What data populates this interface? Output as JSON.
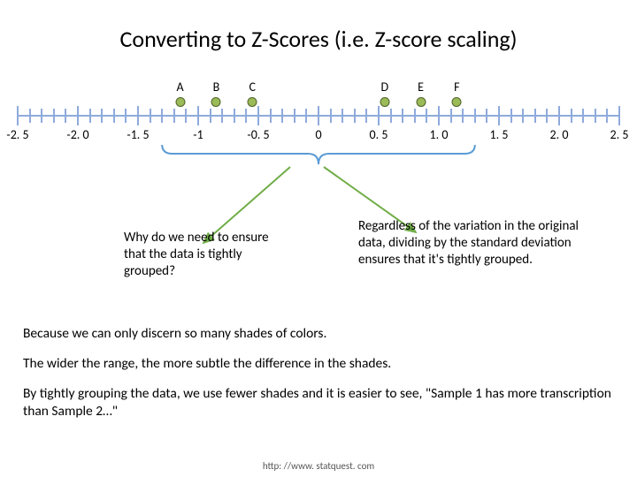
{
  "title": "Converting to Z-Scores (i.e. Z-score scaling)",
  "chart_data": {
    "type": "scatter",
    "xlim": [
      -2.5,
      2.5
    ],
    "xticks_major": [
      -2.5,
      -2.0,
      -1.5,
      -1,
      -0.5,
      0,
      0.5,
      1.0,
      1.5,
      2.0,
      2.5
    ],
    "xtick_labels": [
      "-2. 5",
      "-2. 0",
      "-1. 5",
      "-1",
      "-0. 5",
      "0",
      "0. 5",
      "1. 0",
      "1. 5",
      "2. 0",
      "2. 5"
    ],
    "points": [
      {
        "label": "A",
        "x": -1.15
      },
      {
        "label": "B",
        "x": -0.85
      },
      {
        "label": "C",
        "x": -0.55
      },
      {
        "label": "D",
        "x": 0.55
      },
      {
        "label": "E",
        "x": 0.85
      },
      {
        "label": "F",
        "x": 1.15
      }
    ],
    "brace_range": [
      -1.3,
      1.3
    ],
    "title": "",
    "xlabel": "",
    "ylabel": ""
  },
  "left_text": "Why do we need to ensure that the data is tightly grouped?",
  "right_text": "Regardless of the variation in the original data, dividing by the standard deviation ensures that it's tightly grouped.",
  "para1": "Because we can only discern so many shades of colors.",
  "para2": "The wider the range, the more subtle the difference in the shades.",
  "para3": "By tightly grouping the data, we use fewer shades and it is easier to see, \"Sample 1 has more transcription than Sample 2…\"",
  "footer": "http: //www. statquest. com"
}
